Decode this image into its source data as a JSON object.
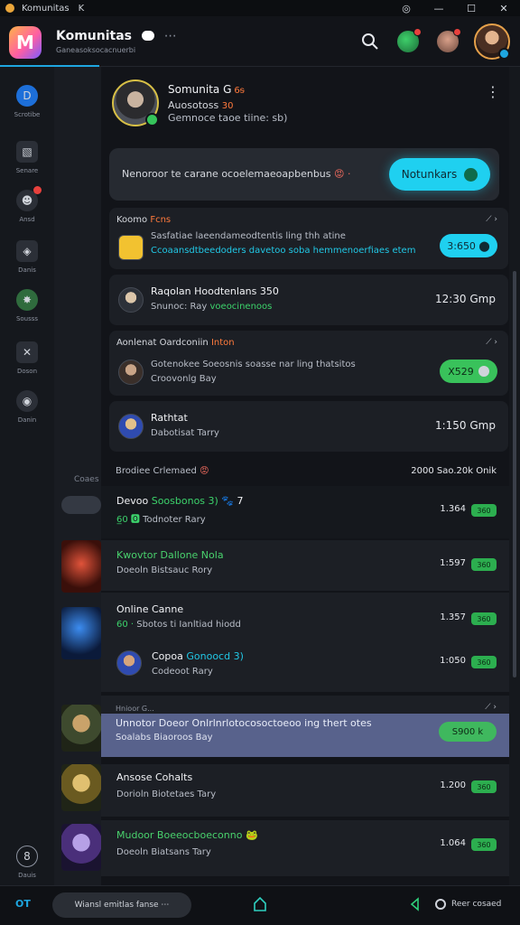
{
  "window": {
    "title": "Komunitas",
    "back": "K",
    "controls": [
      "◎",
      "—",
      "☐",
      "✕"
    ]
  },
  "header": {
    "app_name": "Komunitas",
    "logo_letter": "M",
    "more": "⋯",
    "subtitle": "Ganeasoksocacnuerbi"
  },
  "sidebar": {
    "items": [
      {
        "label": "Scrotibe",
        "glyph": "D"
      },
      {
        "label": "Senare",
        "glyph": "▧"
      },
      {
        "label": "Ansd",
        "glyph": "☻"
      },
      {
        "label": "Danis",
        "glyph": "◈"
      },
      {
        "label": "Sousss",
        "glyph": "✸"
      },
      {
        "label": "Doson",
        "glyph": "✕"
      },
      {
        "label": "Danin",
        "glyph": "◉"
      },
      {
        "label": "Dauis",
        "glyph": "8"
      }
    ]
  },
  "side_panel": {
    "label": "Coaes"
  },
  "profile": {
    "name": "Somunita G",
    "name_tags": "6ᵴ",
    "sub": "Auosotoss",
    "sub_tags": "30",
    "meta": "Gemnoce taoe tiine: sb)"
  },
  "notification": {
    "text": "Nenoroor te carane ocoelemaeoapbenbus",
    "emoji": "😡 ·",
    "button": "Notunkars"
  },
  "community_cards": [
    {
      "title": "Koomo",
      "title_accent": "Fcns",
      "line1": "Sasfatiae laeendameodtentis ling thh atine",
      "line2": "Ccoaansdtbeedoders davetoo soba hemmenoerfiaes etem",
      "action": "3:650 ⬤"
    },
    {
      "title": "Raqolan Hoodtenlans 350",
      "line1": "Snunoc: Ray",
      "line1_accent": "voeocinenoos",
      "time": "12:30 Gmp"
    },
    {
      "title": "Aonlenat Oardconiin",
      "title_accent": "Inton",
      "line1": "Gotenokee Soeosnis soasse nar ling thatsitos",
      "line2": "Croovonlg Bay",
      "action": "X529"
    },
    {
      "title": "Rathtat",
      "line1": "Dabotisat Tarry",
      "time": "1:150 Gmp"
    }
  ],
  "section": {
    "title": "Brodiee Crlemaed",
    "emoji": "😡",
    "meta": "2000 Sao.20k Onik"
  },
  "players": [
    {
      "name": "Devoo",
      "name_accent": "Soosbonos 3)",
      "extra": "🐾 7",
      "sub_accent": "6̲0 🅾",
      "sub": "Todnoter Rary",
      "value": "1.364",
      "tag": "360"
    },
    {
      "name": "Kwovtor Dallone Nola",
      "sub": "Doeoln Bistsauc Rory",
      "value": "1:597",
      "tag": "360"
    },
    {
      "name": "Online Canne",
      "sub_accent": "60 ·",
      "sub": "Sbotos ti Ianltiad hiodd",
      "value": "1.357",
      "tag": "360"
    },
    {
      "name": "Copoa",
      "name_accent": "Gonoocd 3)",
      "sub": "Codeoot Rary",
      "value": "1:050",
      "tag": "360"
    }
  ],
  "highlight": {
    "top": "Hnioor G...",
    "title": "Unnotor Doeor Onlrlnrlotocosoctoeoo ing thert otes",
    "sub": "Soalabs Biaoroos Bay",
    "pill": "S900 k"
  },
  "lower_players": [
    {
      "name": "Ansose Cohalts",
      "sub": "Dorioln Biotetaes Tary",
      "value": "1.200",
      "tag": "360"
    },
    {
      "name": "Mudoor Boeeocboeconno",
      "emoji": "🐸",
      "sub": "Doeoln Biatsans Tary",
      "value": "1.064",
      "tag": "360"
    }
  ],
  "bottom": {
    "left": "OT",
    "pill": "Wiansl emitlas fanse ⋯",
    "status": "Reer cosaed"
  }
}
